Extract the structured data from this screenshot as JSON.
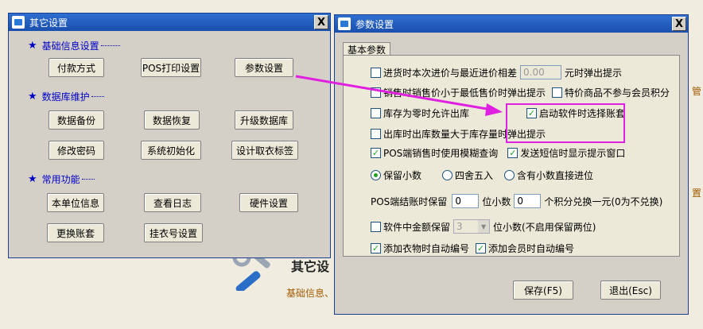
{
  "background": {
    "right_texts": [
      "管",
      "置"
    ],
    "title": "其它设",
    "subtitle": "基础信息、"
  },
  "other_window": {
    "title": "其它设置",
    "close": "X",
    "sections": {
      "basic": "基础信息设置",
      "db": "数据库维护",
      "common": "常用功能"
    },
    "buttons": {
      "payment": "付款方式",
      "pos_print": "POS打印设置",
      "params": "参数设置",
      "backup": "数据备份",
      "restore": "数据恢复",
      "upgrade": "升级数据库",
      "change_pwd": "修改密码",
      "sys_init": "系统初始化",
      "design_tag": "设计取衣标签",
      "unit_info": "本单位信息",
      "view_log": "查看日志",
      "hardware": "硬件设置",
      "switch_account": "更换账套",
      "hanger_no": "挂衣号设置"
    }
  },
  "params_window": {
    "title": "参数设置",
    "close": "X",
    "tab": "基本参数",
    "rows": {
      "r1_label": "进货时本次进价与最近进价相差",
      "r1_value": "0.00",
      "r1_suffix": "元时弹出提示",
      "r2_label": "销售时销售价小于最低售价时弹出提示",
      "r2b_label": "特价商品不参与会员积分",
      "r3_label": "库存为零时允许出库",
      "r3b_label": "启动软件时选择账套",
      "r4_label": "出库时出库数量大于库存量时弹出提示",
      "r5_label": "POS端销售时使用模糊查询",
      "r5b_label": "发送短信时显示提示窗口",
      "radio1": "保留小数",
      "radio2": "四舍五入",
      "radio3": "含有小数直接进位",
      "pos_label": "POS端结账时保留",
      "pos_decimal": "0",
      "pos_decimal_suffix": "位小数",
      "points_value": "0",
      "points_suffix": "个积分兑换一元(0为不兑换)",
      "amount_label": "软件中金额保留",
      "amount_value": "3",
      "amount_suffix": "位小数(不启用保留两位)",
      "auto_cloth": "添加衣物时自动编号",
      "auto_member": "添加会员时自动编号"
    },
    "buttons": {
      "save": "保存(F5)",
      "exit": "退出(Esc)"
    }
  },
  "colors": {
    "accent": "#e020e0",
    "title_bar": "#1a4fae",
    "check": "#21a121",
    "section": "#0000c8"
  }
}
